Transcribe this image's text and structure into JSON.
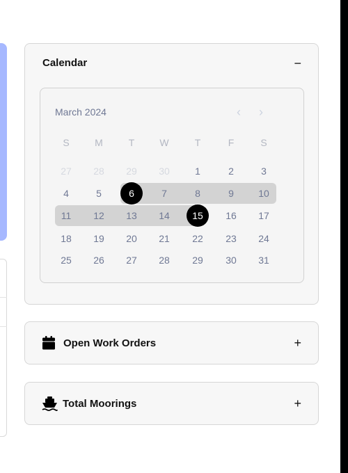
{
  "calendar": {
    "title": "Calendar",
    "collapse_symbol": "−",
    "month_label": "March 2024",
    "weekdays": [
      "S",
      "M",
      "T",
      "W",
      "T",
      "F",
      "S"
    ],
    "weeks": [
      [
        {
          "d": "27",
          "m": true
        },
        {
          "d": "28",
          "m": true
        },
        {
          "d": "29",
          "m": true
        },
        {
          "d": "30",
          "m": true
        },
        {
          "d": "1"
        },
        {
          "d": "2"
        },
        {
          "d": "3"
        }
      ],
      [
        {
          "d": "4"
        },
        {
          "d": "5"
        },
        {
          "d": "6",
          "s": true
        },
        {
          "d": "7"
        },
        {
          "d": "8"
        },
        {
          "d": "9"
        },
        {
          "d": "10"
        }
      ],
      [
        {
          "d": "11"
        },
        {
          "d": "12"
        },
        {
          "d": "13"
        },
        {
          "d": "14"
        },
        {
          "d": "15",
          "s": true
        },
        {
          "d": "16"
        },
        {
          "d": "17"
        }
      ],
      [
        {
          "d": "18"
        },
        {
          "d": "19"
        },
        {
          "d": "20"
        },
        {
          "d": "21"
        },
        {
          "d": "22"
        },
        {
          "d": "23"
        },
        {
          "d": "24"
        }
      ],
      [
        {
          "d": "25"
        },
        {
          "d": "26"
        },
        {
          "d": "27"
        },
        {
          "d": "28"
        },
        {
          "d": "29"
        },
        {
          "d": "30"
        },
        {
          "d": "31"
        }
      ]
    ],
    "range_start": "6",
    "range_end": "15"
  },
  "work_orders": {
    "title": "Open Work Orders",
    "expand_symbol": "+",
    "icon": "calendar-icon"
  },
  "moorings": {
    "title": "Total Moorings",
    "expand_symbol": "+",
    "icon": "boat-icon"
  }
}
